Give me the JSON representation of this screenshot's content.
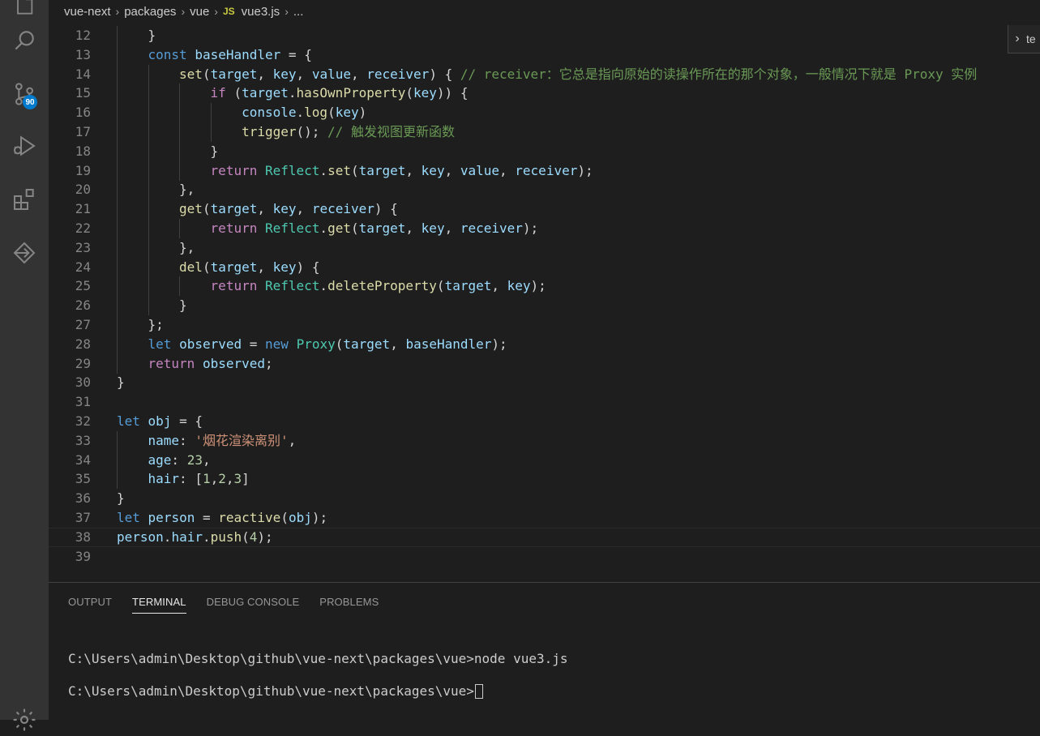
{
  "activity_bar": {
    "icons": [
      "explorer-files-icon",
      "search-icon",
      "source-control-icon",
      "run-debug-icon",
      "extensions-icon",
      "remote-explorer-icon",
      "gear-icon"
    ],
    "source_control_badge": "90"
  },
  "breadcrumb": {
    "items": [
      "vue-next",
      "packages",
      "vue",
      "vue3.js",
      "..."
    ],
    "file_type_badge": "JS"
  },
  "peek_widget": {
    "text": "te"
  },
  "editor": {
    "lines": [
      {
        "n": "12",
        "indent": 1,
        "tokens": [
          [
            "pun",
            "}"
          ]
        ]
      },
      {
        "n": "13",
        "indent": 1,
        "tokens": [
          [
            "kw",
            "const"
          ],
          [
            "pun",
            " "
          ],
          [
            "var",
            "baseHandler"
          ],
          [
            "pun",
            " = {"
          ]
        ]
      },
      {
        "n": "14",
        "indent": 2,
        "tokens": [
          [
            "fn",
            "set"
          ],
          [
            "pun",
            "("
          ],
          [
            "var",
            "target"
          ],
          [
            "pun",
            ", "
          ],
          [
            "var",
            "key"
          ],
          [
            "pun",
            ", "
          ],
          [
            "var",
            "value"
          ],
          [
            "pun",
            ", "
          ],
          [
            "var",
            "receiver"
          ],
          [
            "pun",
            ") { "
          ],
          [
            "cmt",
            "// receiver：它总是指向原始的读操作所在的那个对象，一般情况下就是 Proxy 实例"
          ]
        ]
      },
      {
        "n": "15",
        "indent": 3,
        "tokens": [
          [
            "ctl",
            "if"
          ],
          [
            "pun",
            " ("
          ],
          [
            "var",
            "target"
          ],
          [
            "pun",
            "."
          ],
          [
            "fn",
            "hasOwnProperty"
          ],
          [
            "pun",
            "("
          ],
          [
            "var",
            "key"
          ],
          [
            "pun",
            ")) {"
          ]
        ]
      },
      {
        "n": "16",
        "indent": 4,
        "tokens": [
          [
            "var",
            "console"
          ],
          [
            "pun",
            "."
          ],
          [
            "fn",
            "log"
          ],
          [
            "pun",
            "("
          ],
          [
            "var",
            "key"
          ],
          [
            "pun",
            ")"
          ]
        ]
      },
      {
        "n": "17",
        "indent": 4,
        "tokens": [
          [
            "fn",
            "trigger"
          ],
          [
            "pun",
            "(); "
          ],
          [
            "cmt",
            "// 触发视图更新函数"
          ]
        ]
      },
      {
        "n": "18",
        "indent": 3,
        "tokens": [
          [
            "pun",
            "}"
          ]
        ]
      },
      {
        "n": "19",
        "indent": 3,
        "tokens": [
          [
            "ctl",
            "return"
          ],
          [
            "pun",
            " "
          ],
          [
            "cls",
            "Reflect"
          ],
          [
            "pun",
            "."
          ],
          [
            "fn",
            "set"
          ],
          [
            "pun",
            "("
          ],
          [
            "var",
            "target"
          ],
          [
            "pun",
            ", "
          ],
          [
            "var",
            "key"
          ],
          [
            "pun",
            ", "
          ],
          [
            "var",
            "value"
          ],
          [
            "pun",
            ", "
          ],
          [
            "var",
            "receiver"
          ],
          [
            "pun",
            ");"
          ]
        ]
      },
      {
        "n": "20",
        "indent": 2,
        "tokens": [
          [
            "pun",
            "},"
          ]
        ]
      },
      {
        "n": "21",
        "indent": 2,
        "tokens": [
          [
            "fn",
            "get"
          ],
          [
            "pun",
            "("
          ],
          [
            "var",
            "target"
          ],
          [
            "pun",
            ", "
          ],
          [
            "var",
            "key"
          ],
          [
            "pun",
            ", "
          ],
          [
            "var",
            "receiver"
          ],
          [
            "pun",
            ") {"
          ]
        ]
      },
      {
        "n": "22",
        "indent": 3,
        "tokens": [
          [
            "ctl",
            "return"
          ],
          [
            "pun",
            " "
          ],
          [
            "cls",
            "Reflect"
          ],
          [
            "pun",
            "."
          ],
          [
            "fn",
            "get"
          ],
          [
            "pun",
            "("
          ],
          [
            "var",
            "target"
          ],
          [
            "pun",
            ", "
          ],
          [
            "var",
            "key"
          ],
          [
            "pun",
            ", "
          ],
          [
            "var",
            "receiver"
          ],
          [
            "pun",
            ");"
          ]
        ]
      },
      {
        "n": "23",
        "indent": 2,
        "tokens": [
          [
            "pun",
            "},"
          ]
        ]
      },
      {
        "n": "24",
        "indent": 2,
        "tokens": [
          [
            "fn",
            "del"
          ],
          [
            "pun",
            "("
          ],
          [
            "var",
            "target"
          ],
          [
            "pun",
            ", "
          ],
          [
            "var",
            "key"
          ],
          [
            "pun",
            ") {"
          ]
        ]
      },
      {
        "n": "25",
        "indent": 3,
        "tokens": [
          [
            "ctl",
            "return"
          ],
          [
            "pun",
            " "
          ],
          [
            "cls",
            "Reflect"
          ],
          [
            "pun",
            "."
          ],
          [
            "fn",
            "deleteProperty"
          ],
          [
            "pun",
            "("
          ],
          [
            "var",
            "target"
          ],
          [
            "pun",
            ", "
          ],
          [
            "var",
            "key"
          ],
          [
            "pun",
            ");"
          ]
        ]
      },
      {
        "n": "26",
        "indent": 2,
        "tokens": [
          [
            "pun",
            "}"
          ]
        ]
      },
      {
        "n": "27",
        "indent": 1,
        "tokens": [
          [
            "pun",
            "};"
          ]
        ]
      },
      {
        "n": "28",
        "indent": 1,
        "tokens": [
          [
            "kw",
            "let"
          ],
          [
            "pun",
            " "
          ],
          [
            "var",
            "observed"
          ],
          [
            "pun",
            " = "
          ],
          [
            "kw",
            "new"
          ],
          [
            "pun",
            " "
          ],
          [
            "cls",
            "Proxy"
          ],
          [
            "pun",
            "("
          ],
          [
            "var",
            "target"
          ],
          [
            "pun",
            ", "
          ],
          [
            "var",
            "baseHandler"
          ],
          [
            "pun",
            ");"
          ]
        ]
      },
      {
        "n": "29",
        "indent": 1,
        "tokens": [
          [
            "ctl",
            "return"
          ],
          [
            "pun",
            " "
          ],
          [
            "var",
            "observed"
          ],
          [
            "pun",
            ";"
          ]
        ]
      },
      {
        "n": "30",
        "indent": 0,
        "tokens": [
          [
            "pun",
            "}"
          ]
        ]
      },
      {
        "n": "31",
        "indent": 0,
        "tokens": []
      },
      {
        "n": "32",
        "indent": 0,
        "tokens": [
          [
            "kw",
            "let"
          ],
          [
            "pun",
            " "
          ],
          [
            "var",
            "obj"
          ],
          [
            "pun",
            " = {"
          ]
        ]
      },
      {
        "n": "33",
        "indent": 1,
        "tokens": [
          [
            "var",
            "name"
          ],
          [
            "pun",
            ": "
          ],
          [
            "str",
            "'烟花渲染离别'"
          ],
          [
            "pun",
            ","
          ]
        ]
      },
      {
        "n": "34",
        "indent": 1,
        "tokens": [
          [
            "var",
            "age"
          ],
          [
            "pun",
            ": "
          ],
          [
            "num",
            "23"
          ],
          [
            "pun",
            ","
          ]
        ]
      },
      {
        "n": "35",
        "indent": 1,
        "tokens": [
          [
            "var",
            "hair"
          ],
          [
            "pun",
            ": ["
          ],
          [
            "num",
            "1"
          ],
          [
            "pun",
            ","
          ],
          [
            "num",
            "2"
          ],
          [
            "pun",
            ","
          ],
          [
            "num",
            "3"
          ],
          [
            "pun",
            "]"
          ]
        ]
      },
      {
        "n": "36",
        "indent": 0,
        "tokens": [
          [
            "pun",
            "}"
          ]
        ]
      },
      {
        "n": "37",
        "indent": 0,
        "tokens": [
          [
            "kw",
            "let"
          ],
          [
            "pun",
            " "
          ],
          [
            "var",
            "person"
          ],
          [
            "pun",
            " = "
          ],
          [
            "fn",
            "reactive"
          ],
          [
            "pun",
            "("
          ],
          [
            "var",
            "obj"
          ],
          [
            "pun",
            ");"
          ]
        ]
      },
      {
        "n": "38",
        "indent": 0,
        "current": true,
        "tokens": [
          [
            "var",
            "person"
          ],
          [
            "pun",
            "."
          ],
          [
            "var",
            "hair"
          ],
          [
            "pun",
            "."
          ],
          [
            "fn",
            "push"
          ],
          [
            "pun",
            "("
          ],
          [
            "num",
            "4"
          ],
          [
            "pun",
            ");"
          ]
        ]
      },
      {
        "n": "39",
        "indent": 0,
        "tokens": []
      }
    ]
  },
  "panel": {
    "tabs": [
      {
        "label": "OUTPUT",
        "active": false
      },
      {
        "label": "TERMINAL",
        "active": true
      },
      {
        "label": "DEBUG CONSOLE",
        "active": false
      },
      {
        "label": "PROBLEMS",
        "active": false
      }
    ],
    "terminal": {
      "line1": "C:\\Users\\admin\\Desktop\\github\\vue-next\\packages\\vue>node vue3.js",
      "line2": "C:\\Users\\admin\\Desktop\\github\\vue-next\\packages\\vue>"
    }
  }
}
